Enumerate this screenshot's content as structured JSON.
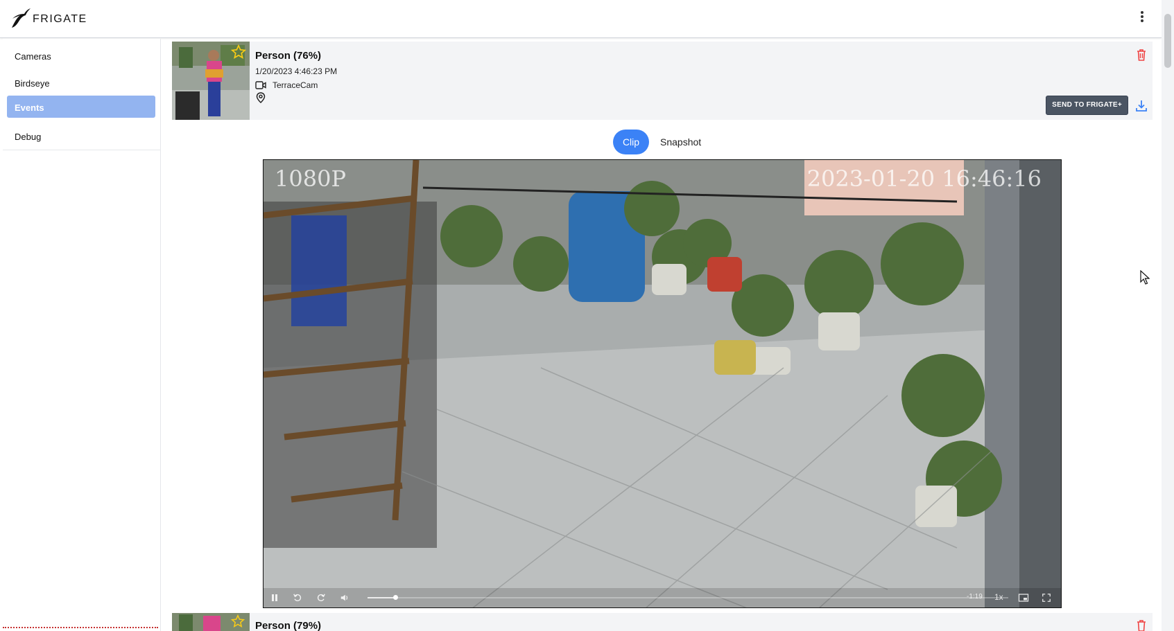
{
  "app": {
    "brand": "FRIGATE"
  },
  "sidebar": {
    "items": [
      {
        "label": "Cameras",
        "active": false
      },
      {
        "label": "Birdseye",
        "active": false
      },
      {
        "label": "Events",
        "active": true
      },
      {
        "label": "Debug",
        "active": false
      }
    ]
  },
  "events": [
    {
      "title": "Person (76%)",
      "time": "1/20/2023 4:46:23 PM",
      "camera": "TerraceCam",
      "send_label": "SEND TO FRIGATE+",
      "favorite": false
    },
    {
      "title": "Person (79%)"
    }
  ],
  "view_toggle": {
    "clip_label": "Clip",
    "snapshot_label": "Snapshot",
    "selected": "Clip"
  },
  "player": {
    "osd_left": "1080P",
    "osd_right": "2023-01-20 16:46:16",
    "remaining": "-1:19",
    "rate": "1x",
    "progress": 0.04
  },
  "colors": {
    "accent": "#3b82f6",
    "active_nav": "#93b4f0",
    "danger": "#ef4444",
    "card_bg": "#f3f4f6"
  }
}
